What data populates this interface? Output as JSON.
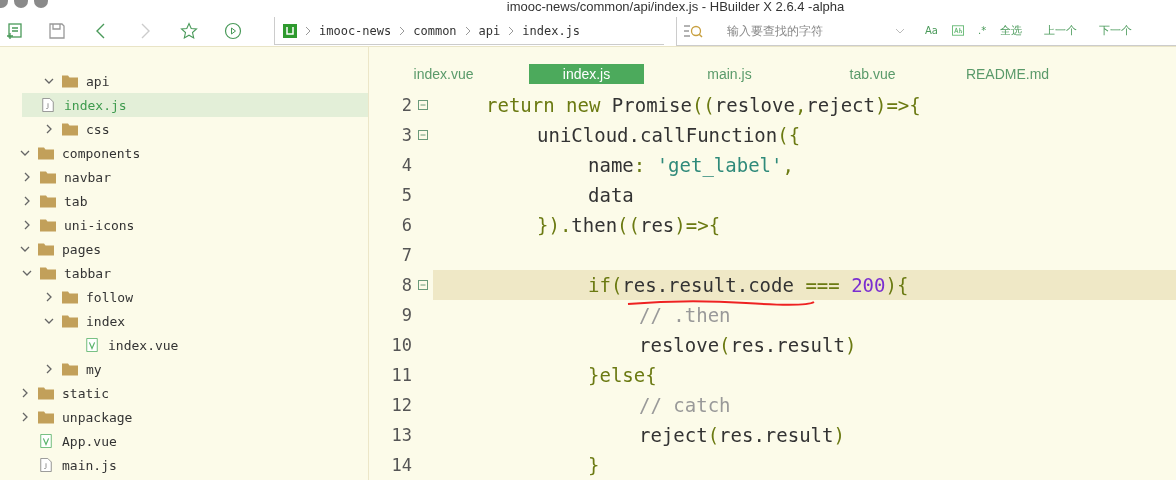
{
  "window": {
    "title": "imooc-news/common/api/index.js - HBuilder X 2.6.4 -alpha"
  },
  "toolbar": {
    "forward_disabled": true
  },
  "breadcrumb": [
    "imooc-news",
    "common",
    "api",
    "index.js"
  ],
  "search": {
    "placeholder": "输入要查找的字符",
    "options": [
      "Aa",
      ".*"
    ],
    "actions": [
      "全选",
      "上一个",
      "下一个"
    ]
  },
  "tree": [
    {
      "label": "api",
      "kind": "folder",
      "expanded": true,
      "selected": false,
      "children": [
        {
          "label": "index.js",
          "kind": "js",
          "selected": true
        }
      ]
    },
    {
      "label": "css",
      "kind": "folder",
      "expanded": false,
      "selected": false
    }
  ],
  "tree_root": [
    {
      "label": "components",
      "kind": "folder",
      "expanded": true,
      "selected": false,
      "children": [
        {
          "label": "navbar",
          "kind": "folder",
          "expanded": false,
          "selected": false
        },
        {
          "label": "tab",
          "kind": "folder",
          "expanded": false,
          "selected": false
        },
        {
          "label": "uni-icons",
          "kind": "folder",
          "expanded": false,
          "selected": false
        }
      ]
    },
    {
      "label": "pages",
      "kind": "folder",
      "expanded": true,
      "selected": false,
      "children": [
        {
          "label": "tabbar",
          "kind": "folder",
          "expanded": true,
          "selected": false,
          "children": [
            {
              "label": "follow",
              "kind": "folder",
              "expanded": false,
              "selected": false
            },
            {
              "label": "index",
              "kind": "folder",
              "expanded": true,
              "selected": false,
              "children": [
                {
                  "label": "index.vue",
                  "kind": "vue",
                  "selected": false
                }
              ]
            },
            {
              "label": "my",
              "kind": "folder",
              "expanded": false,
              "selected": false
            }
          ]
        }
      ]
    },
    {
      "label": "static",
      "kind": "folder",
      "expanded": false,
      "selected": false
    },
    {
      "label": "unpackage",
      "kind": "folder",
      "expanded": false,
      "selected": false
    },
    {
      "label": "App.vue",
      "kind": "vue",
      "selected": false
    },
    {
      "label": "main.js",
      "kind": "js",
      "selected": false
    }
  ],
  "tabs": [
    {
      "label": "index.vue",
      "selected": false
    },
    {
      "label": "index.js",
      "selected": true
    },
    {
      "label": "main.js",
      "selected": false
    },
    {
      "label": "tab.vue",
      "selected": false
    },
    {
      "label": "README.md",
      "selected": false
    }
  ],
  "code": [
    {
      "number": "2",
      "fold": true,
      "highlighted": false,
      "tokens": [
        {
          "text": "return new ",
          "kind": "keyword"
        },
        {
          "text": "Promise",
          "kind": "name"
        },
        {
          "text": "((",
          "kind": "punct"
        },
        {
          "text": "reslove",
          "kind": "name"
        },
        {
          "text": ",",
          "kind": "punct"
        },
        {
          "text": "reject",
          "kind": "name"
        },
        {
          "text": ")=>{",
          "kind": "punct"
        }
      ],
      "children": [
        {
          "number": "3",
          "fold": true,
          "highlighted": false,
          "tokens": [
            {
              "text": "uniCloud.callFunction",
              "kind": "name"
            },
            {
              "text": "({",
              "kind": "punct"
            }
          ],
          "children": [
            {
              "number": "4",
              "fold": false,
              "highlighted": false,
              "tokens": [
                {
                  "text": "name",
                  "kind": "name"
                },
                {
                  "text": ": ",
                  "kind": "punct"
                },
                {
                  "text": "'get_label'",
                  "kind": "string"
                },
                {
                  "text": ",",
                  "kind": "punct"
                }
              ]
            },
            {
              "number": "5",
              "fold": false,
              "highlighted": false,
              "tokens": [
                {
                  "text": "data",
                  "kind": "name"
                }
              ]
            }
          ]
        },
        {
          "number": "6",
          "fold": false,
          "highlighted": false,
          "tokens": [
            {
              "text": "}).",
              "kind": "punct"
            },
            {
              "text": "then",
              "kind": "name"
            },
            {
              "text": "((",
              "kind": "punct"
            },
            {
              "text": "res",
              "kind": "name"
            },
            {
              "text": ")=>{",
              "kind": "punct"
            }
          ],
          "children": [
            {
              "number": "7",
              "fold": false,
              "highlighted": false
            },
            {
              "number": "8",
              "fold": true,
              "highlighted": true,
              "tokens": [
                {
                  "text": "if",
                  "kind": "keyword"
                },
                {
                  "text": "(",
                  "kind": "punct"
                },
                {
                  "text": "res.result.code",
                  "kind": "name"
                },
                {
                  "text": " === ",
                  "kind": "punct"
                },
                {
                  "text": "200",
                  "kind": "number"
                },
                {
                  "text": "){",
                  "kind": "punct"
                }
              ],
              "children": [
                {
                  "number": "9",
                  "fold": false,
                  "highlighted": false,
                  "tokens": [
                    {
                      "text": "// .then",
                      "kind": "comment"
                    }
                  ]
                },
                {
                  "number": "10",
                  "fold": false,
                  "highlighted": false,
                  "tokens": [
                    {
                      "text": "reslove",
                      "kind": "name"
                    },
                    {
                      "text": "(",
                      "kind": "punct"
                    },
                    {
                      "text": "res.result",
                      "kind": "name"
                    },
                    {
                      "text": ")",
                      "kind": "punct"
                    }
                  ]
                }
              ]
            },
            {
              "number": "11",
              "fold": false,
              "highlighted": false,
              "tokens": [
                {
                  "text": "}else{",
                  "kind": "punct"
                }
              ],
              "children": [
                {
                  "number": "12",
                  "fold": false,
                  "highlighted": false,
                  "tokens": [
                    {
                      "text": "// catch",
                      "kind": "comment"
                    }
                  ]
                },
                {
                  "number": "13",
                  "fold": false,
                  "highlighted": false,
                  "tokens": [
                    {
                      "text": "reject",
                      "kind": "name"
                    },
                    {
                      "text": "(",
                      "kind": "punct"
                    },
                    {
                      "text": "res.result",
                      "kind": "name"
                    },
                    {
                      "text": ")",
                      "kind": "punct"
                    }
                  ]
                }
              ]
            },
            {
              "number": "14",
              "fold": false,
              "highlighted": false,
              "tokens": [
                {
                  "text": "}",
                  "kind": "punct"
                }
              ]
            }
          ]
        }
      ]
    }
  ]
}
